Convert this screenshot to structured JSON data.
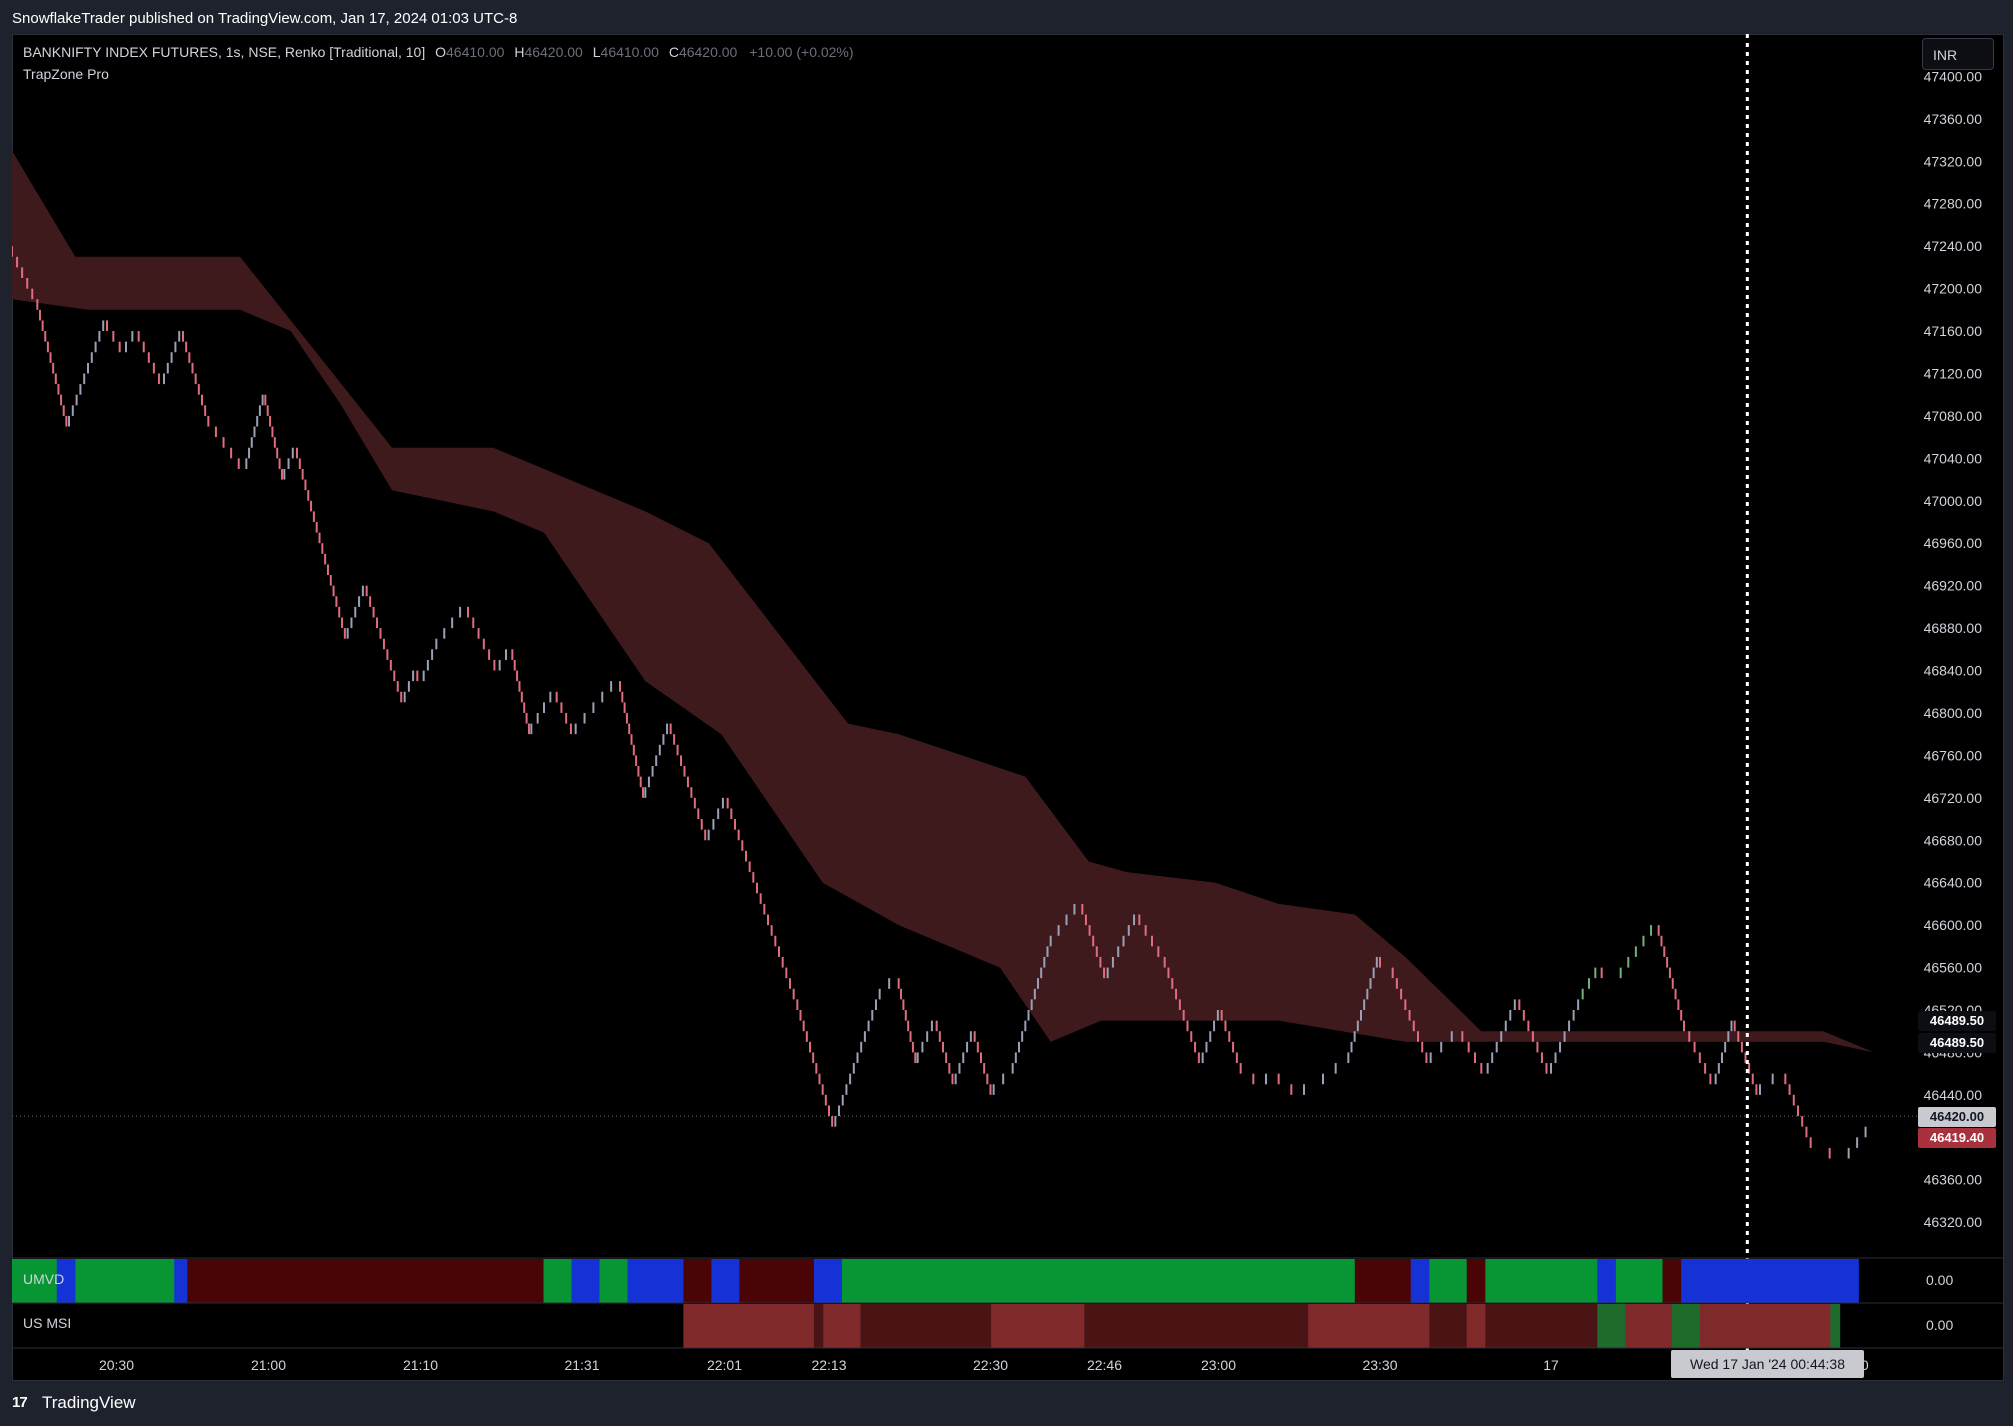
{
  "header": {
    "published_by": "SnowflakeTrader published on TradingView.com, Jan 17, 2024 01:03 UTC-8"
  },
  "legend": {
    "symbol": "BANKNIFTY INDEX FUTURES, 1s, NSE, Renko [Traditional, 10]",
    "open_label": "O",
    "open": "46410.00",
    "high_label": "H",
    "high": "46420.00",
    "low_label": "L",
    "low": "46410.00",
    "close_label": "C",
    "close": "46420.00",
    "change": "+10.00 (+0.02%)"
  },
  "indicator": {
    "name": "TrapZone Pro"
  },
  "currency": "INR",
  "price_tags": {
    "upper1": "46489.50",
    "upper2": "46489.50",
    "last": "46420.00",
    "red": "46419.40"
  },
  "panes": {
    "umvd": {
      "label": "UMVD",
      "value": "0.00"
    },
    "usmsi": {
      "label": "US MSI",
      "value": "0.00"
    }
  },
  "crosshair_time": "Wed 17 Jan '24   00:44:38",
  "brand": {
    "logo": "17",
    "name": "TradingView"
  },
  "colors": {
    "background": "#000000",
    "zone_fill": "#3f1a1d",
    "bear_brick": "#e06d7e",
    "bull_brick": "#9aa0b5",
    "strong_bull_brick": "#6fb27a",
    "umvd_green": "#089635",
    "umvd_maroon": "#4a0406",
    "umvd_blue": "#1432d6",
    "msi_red": "#802a2c",
    "msi_dark": "#4a1414",
    "msi_green": "#1e6b2c"
  },
  "chart_data": {
    "type": "line",
    "subtype": "renko",
    "y_axis": {
      "range": [
        46290,
        47440
      ],
      "ticks": [
        47400,
        47360,
        47320,
        47280,
        47240,
        47200,
        47160,
        47120,
        47080,
        47040,
        47000,
        46960,
        46920,
        46880,
        46840,
        46800,
        46760,
        46720,
        46680,
        46640,
        46600,
        46560,
        46520,
        46480,
        46440,
        46400,
        46360,
        46320
      ],
      "tick_labels": [
        "47400.00",
        "47360.00",
        "47320.00",
        "47280.00",
        "47240.00",
        "47200.00",
        "47160.00",
        "47120.00",
        "47080.00",
        "47040.00",
        "47000.00",
        "46960.00",
        "46920.00",
        "46880.00",
        "46840.00",
        "46800.00",
        "46760.00",
        "46720.00",
        "46680.00",
        "46640.00",
        "46600.00",
        "46560.00",
        "46520.00",
        "46480.00",
        "46440.00",
        "46400.00",
        "46360.00",
        "46320.00"
      ]
    },
    "x_axis": {
      "labels": [
        "20:30",
        "21:00",
        "21:10",
        "21:31",
        "22:01",
        "22:13",
        "22:30",
        "22:46",
        "23:00",
        "23:30",
        "17",
        "1:00"
      ],
      "positions": [
        0.055,
        0.135,
        0.215,
        0.3,
        0.375,
        0.43,
        0.515,
        0.575,
        0.635,
        0.72,
        0.81,
        0.97
      ]
    },
    "price_path": [
      [
        0.0,
        47240
      ],
      [
        0.02,
        47190
      ],
      [
        0.045,
        47070
      ],
      [
        0.075,
        47170
      ],
      [
        0.09,
        47140
      ],
      [
        0.1,
        47160
      ],
      [
        0.12,
        47110
      ],
      [
        0.135,
        47160
      ],
      [
        0.155,
        47080
      ],
      [
        0.185,
        47030
      ],
      [
        0.2,
        47100
      ],
      [
        0.215,
        47020
      ],
      [
        0.225,
        47050
      ],
      [
        0.265,
        46870
      ],
      [
        0.28,
        46920
      ],
      [
        0.31,
        46810
      ],
      [
        0.32,
        46840
      ],
      [
        0.325,
        46830
      ],
      [
        0.335,
        46860
      ],
      [
        0.36,
        46900
      ],
      [
        0.385,
        46840
      ],
      [
        0.395,
        46860
      ],
      [
        0.41,
        46780
      ],
      [
        0.43,
        46820
      ],
      [
        0.445,
        46780
      ],
      [
        0.48,
        46830
      ],
      [
        0.5,
        46720
      ],
      [
        0.52,
        46790
      ],
      [
        0.55,
        46680
      ],
      [
        0.565,
        46720
      ],
      [
        0.62,
        46530
      ],
      [
        0.65,
        46410
      ],
      [
        0.685,
        46530
      ],
      [
        0.7,
        46550
      ],
      [
        0.715,
        46470
      ],
      [
        0.73,
        46510
      ],
      [
        0.745,
        46450
      ],
      [
        0.76,
        46500
      ],
      [
        0.775,
        46440
      ],
      [
        0.79,
        46460
      ],
      [
        0.82,
        46580
      ],
      [
        0.845,
        46620
      ],
      [
        0.865,
        46550
      ],
      [
        0.89,
        46610
      ],
      [
        0.91,
        46570
      ],
      [
        0.94,
        46470
      ],
      [
        0.955,
        46520
      ],
      [
        0.97,
        46470
      ],
      [
        0.99,
        46450
      ],
      [
        1.0,
        46460
      ],
      [
        1.02,
        46440
      ],
      [
        1.035,
        46450
      ],
      [
        1.055,
        46470
      ],
      [
        1.08,
        46570
      ],
      [
        1.09,
        46560
      ],
      [
        1.12,
        46470
      ],
      [
        1.145,
        46500
      ],
      [
        1.165,
        46460
      ],
      [
        1.19,
        46530
      ],
      [
        1.215,
        46460
      ],
      [
        1.24,
        46530
      ],
      [
        1.255,
        46560
      ],
      [
        1.27,
        46550
      ],
      [
        1.3,
        46600
      ],
      [
        1.32,
        46510
      ],
      [
        1.345,
        46450
      ],
      [
        1.36,
        46510
      ],
      [
        1.38,
        46440
      ],
      [
        1.4,
        46460
      ],
      [
        1.42,
        46400
      ],
      [
        1.45,
        46380
      ],
      [
        1.47,
        46410
      ]
    ],
    "trap_zone_upper": [
      [
        0.0,
        47330
      ],
      [
        0.05,
        47230
      ],
      [
        0.18,
        47230
      ],
      [
        0.22,
        47170
      ],
      [
        0.3,
        47050
      ],
      [
        0.38,
        47050
      ],
      [
        0.5,
        46990
      ],
      [
        0.55,
        46960
      ],
      [
        0.66,
        46790
      ],
      [
        0.7,
        46780
      ],
      [
        0.8,
        46740
      ],
      [
        0.85,
        46660
      ],
      [
        0.88,
        46650
      ],
      [
        0.95,
        46640
      ],
      [
        1.0,
        46620
      ],
      [
        1.06,
        46610
      ],
      [
        1.1,
        46570
      ],
      [
        1.16,
        46500
      ],
      [
        1.3,
        46500
      ],
      [
        1.35,
        46500
      ],
      [
        1.43,
        46500
      ],
      [
        1.47,
        46480
      ]
    ],
    "trap_zone_lower": [
      [
        0.0,
        47190
      ],
      [
        0.06,
        47180
      ],
      [
        0.18,
        47180
      ],
      [
        0.22,
        47160
      ],
      [
        0.26,
        47090
      ],
      [
        0.3,
        47010
      ],
      [
        0.38,
        46990
      ],
      [
        0.42,
        46970
      ],
      [
        0.5,
        46830
      ],
      [
        0.56,
        46780
      ],
      [
        0.64,
        46640
      ],
      [
        0.7,
        46600
      ],
      [
        0.78,
        46560
      ],
      [
        0.82,
        46490
      ],
      [
        0.86,
        46510
      ],
      [
        0.95,
        46510
      ],
      [
        1.0,
        46510
      ],
      [
        1.1,
        46490
      ],
      [
        1.2,
        46490
      ],
      [
        1.35,
        46490
      ],
      [
        1.43,
        46490
      ],
      [
        1.47,
        46480
      ]
    ],
    "last_price": 46420,
    "crosshair_x": 1.37
  }
}
